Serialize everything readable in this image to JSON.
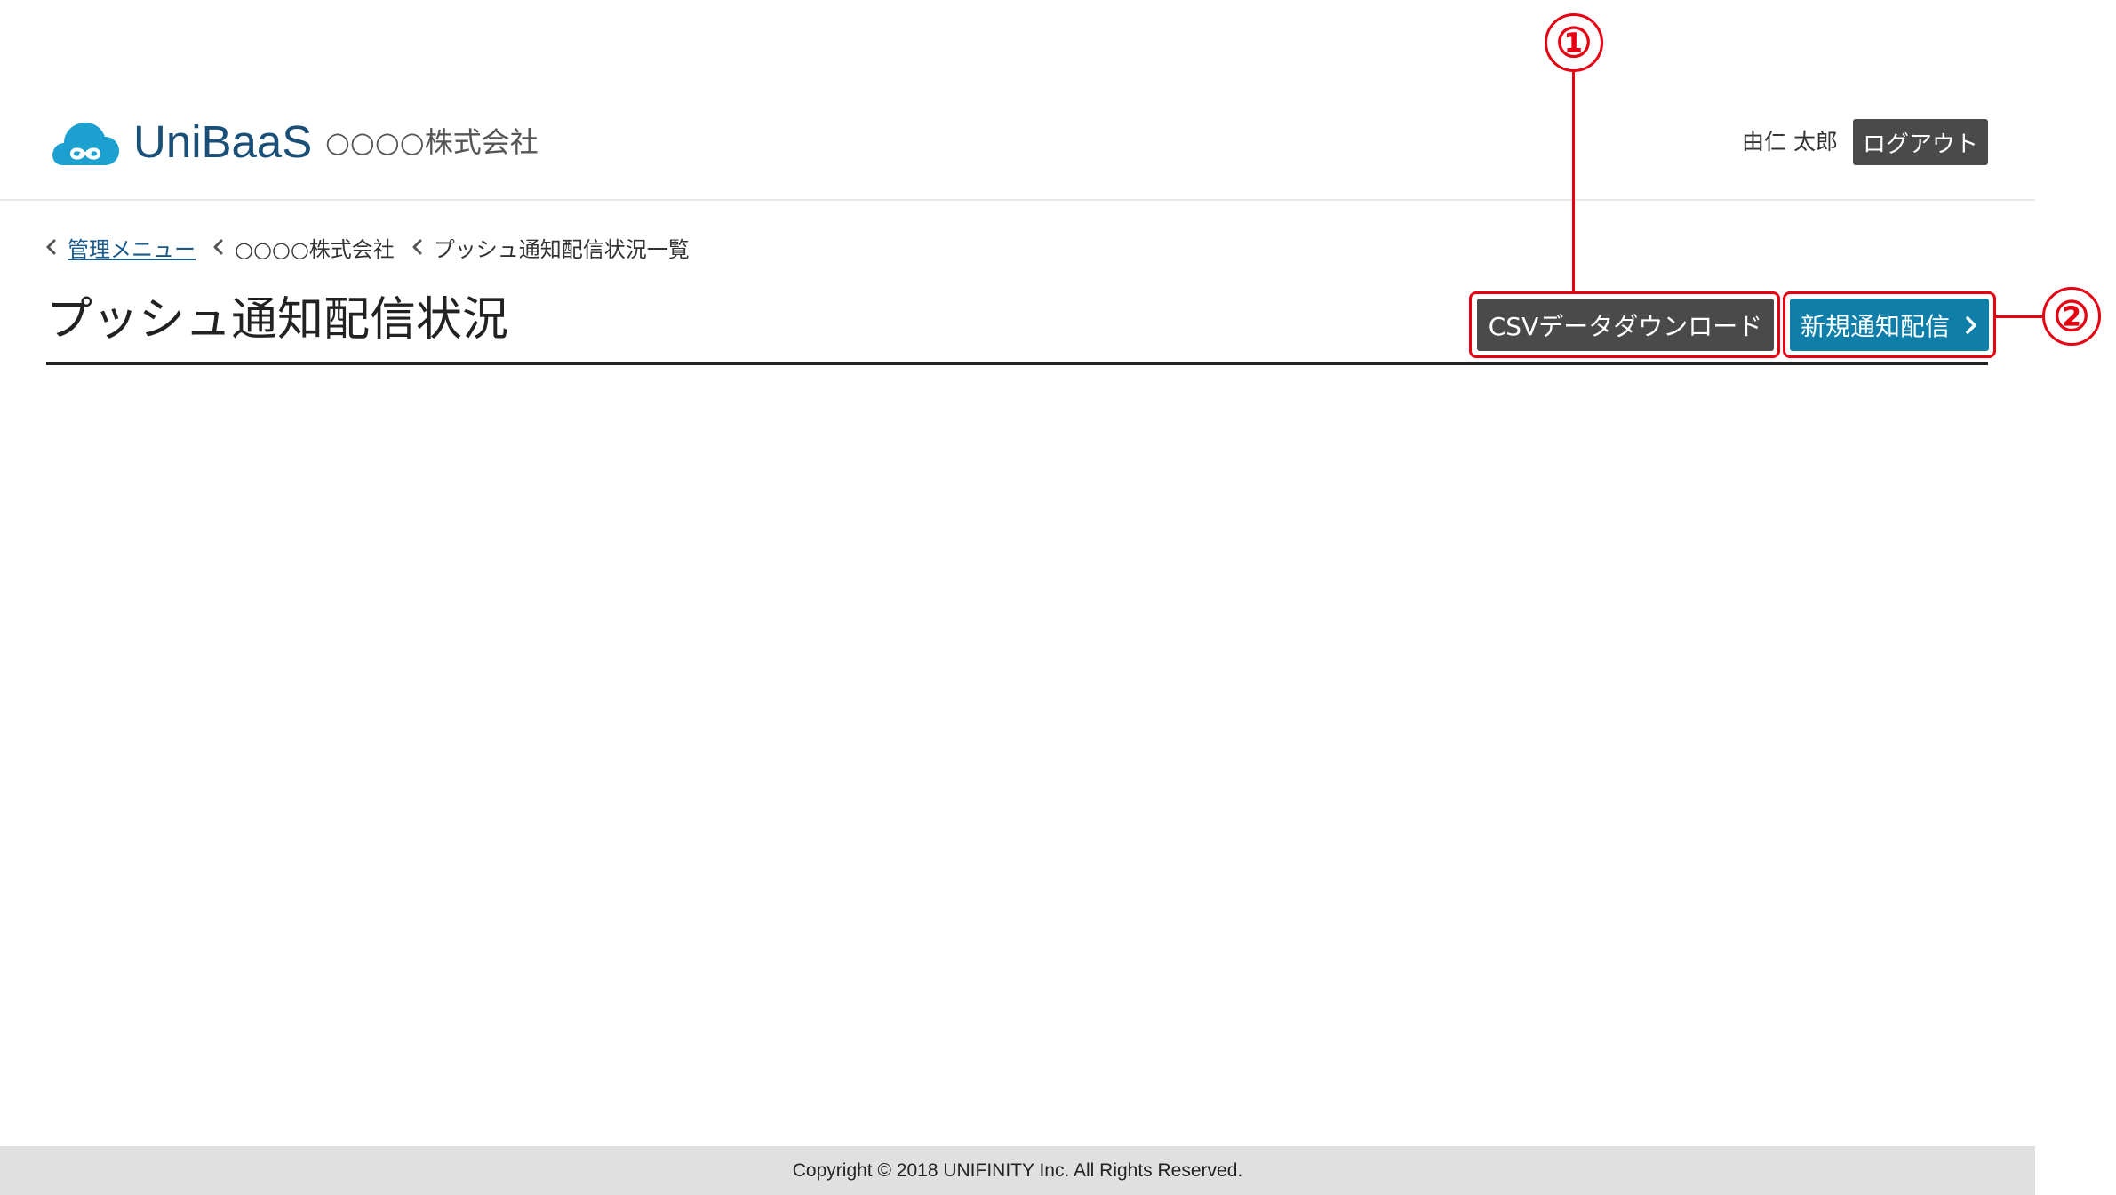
{
  "header": {
    "brand": "UniBaaS",
    "company": "○○○○株式会社",
    "user_name": "由仁 太郎",
    "logout_label": "ログアウト",
    "logo_icon": "cloud-link-icon",
    "brand_color": "#1a4f78",
    "icon_color": "#1ba0cf"
  },
  "breadcrumb": {
    "items": [
      {
        "label": "管理メニュー",
        "link": true
      },
      {
        "label": "○○○○株式会社",
        "link": false
      },
      {
        "label": "プッシュ通知配信状況一覧",
        "link": false
      }
    ]
  },
  "page": {
    "title": "プッシュ通知配信状況"
  },
  "actions": {
    "csv_label": "CSVデータダウンロード",
    "new_label": "新規通知配信",
    "new_icon": "chevron-right-icon",
    "csv_color": "#4a4a4a",
    "new_color": "#0f7fa9"
  },
  "callouts": {
    "one": "①",
    "two": "②",
    "color": "#e60012"
  },
  "footer": {
    "copyright": "Copyright © 2018 UNIFINITY Inc. All Rights Reserved."
  }
}
